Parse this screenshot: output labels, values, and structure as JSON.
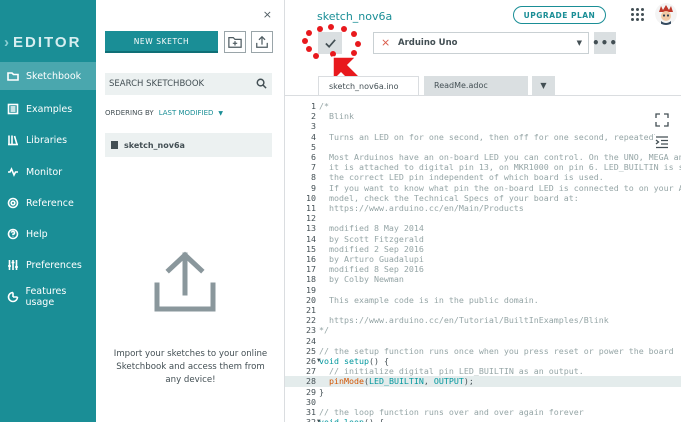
{
  "nav": {
    "logo": "EDITOR",
    "items": [
      {
        "label": "Sketchbook",
        "icon": "folder-icon"
      },
      {
        "label": "Examples",
        "icon": "book-icon"
      },
      {
        "label": "Libraries",
        "icon": "library-icon"
      },
      {
        "label": "Monitor",
        "icon": "monitor-icon"
      },
      {
        "label": "Reference",
        "icon": "reference-icon"
      },
      {
        "label": "Help",
        "icon": "help-icon"
      },
      {
        "label": "Preferences",
        "icon": "sliders-icon"
      },
      {
        "label": "Features usage",
        "icon": "usage-icon"
      }
    ]
  },
  "panel": {
    "close": "×",
    "new_sketch": "NEW SKETCH",
    "search_placeholder": "SEARCH SKETCHBOOK",
    "ordering_label": "ORDERING BY",
    "ordering_value": "LAST MODIFIED",
    "sketches": [
      "sketch_nov6a"
    ],
    "import_text": "Import your sketches to your online Sketchbook and access them from any device!"
  },
  "editor": {
    "sketch_title": "sketch_nov6a",
    "upgrade": "UPGRADE PLAN",
    "board": "Arduino Uno",
    "more": "•••",
    "tabs": [
      "sketch_nov6a.ino",
      "ReadMe.adoc"
    ],
    "code_lines": [
      {
        "n": "1",
        "t": "/*"
      },
      {
        "n": "2",
        "t": "  Blink"
      },
      {
        "n": "3",
        "t": ""
      },
      {
        "n": "4",
        "t": "  Turns an LED on for one second, then off for one second, repeatedly."
      },
      {
        "n": "5",
        "t": ""
      },
      {
        "n": "6",
        "t": "  Most Arduinos have an on-board LED you can control. On the UNO, MEGA and ZERO"
      },
      {
        "n": "7",
        "t": "  it is attached to digital pin 13, on MKR1000 on pin 6. LED_BUILTIN is set to"
      },
      {
        "n": "8",
        "t": "  the correct LED pin independent of which board is used."
      },
      {
        "n": "9",
        "t": "  If you want to know what pin the on-board LED is connected to on your Arduino"
      },
      {
        "n": "10",
        "t": "  model, check the Technical Specs of your board at:"
      },
      {
        "n": "11",
        "t": "  https://www.arduino.cc/en/Main/Products"
      },
      {
        "n": "12",
        "t": ""
      },
      {
        "n": "13",
        "t": "  modified 8 May 2014"
      },
      {
        "n": "14",
        "t": "  by Scott Fitzgerald"
      },
      {
        "n": "15",
        "t": "  modified 2 Sep 2016"
      },
      {
        "n": "16",
        "t": "  by Arturo Guadalupi"
      },
      {
        "n": "17",
        "t": "  modified 8 Sep 2016"
      },
      {
        "n": "18",
        "t": "  by Colby Newman"
      },
      {
        "n": "19",
        "t": ""
      },
      {
        "n": "20",
        "t": "  This example code is in the public domain."
      },
      {
        "n": "21",
        "t": ""
      },
      {
        "n": "22",
        "t": "  https://www.arduino.cc/en/Tutorial/BuiltInExamples/Blink"
      },
      {
        "n": "23",
        "t": "*/"
      },
      {
        "n": "24",
        "t": ""
      },
      {
        "n": "25",
        "t": "// the setup function runs once when you press reset or power the board"
      },
      {
        "n": "26",
        "t": "void setup() {",
        "fold": true
      },
      {
        "n": "27",
        "t": "  // initialize digital pin LED_BUILTIN as an output."
      },
      {
        "n": "28",
        "t": "  pinMode(LED_BUILTIN, OUTPUT);",
        "highlight": true
      },
      {
        "n": "29",
        "t": "}"
      },
      {
        "n": "30",
        "t": ""
      },
      {
        "n": "31",
        "t": "// the loop function runs over and over again forever"
      },
      {
        "n": "32",
        "t": "void loop() {",
        "fold": true
      }
    ]
  },
  "colors": {
    "accent": "#1a8e96",
    "annotation": "#e8191d"
  }
}
